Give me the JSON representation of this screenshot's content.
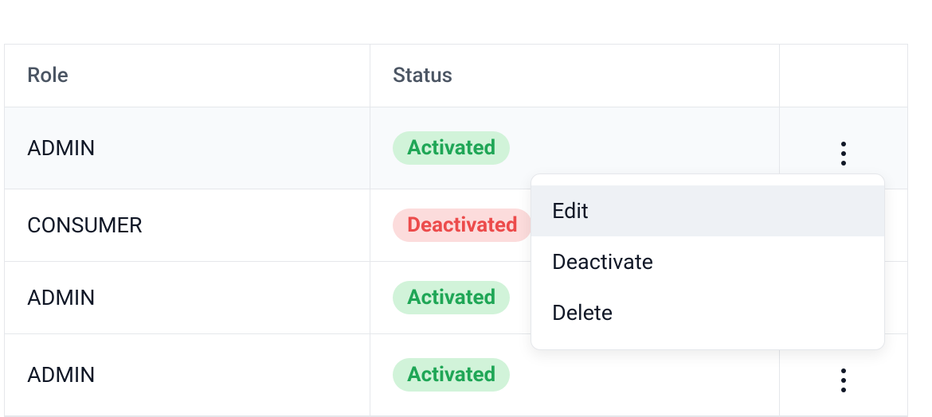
{
  "table": {
    "headers": {
      "role": "Role",
      "status": "Status",
      "actions": ""
    },
    "rows": [
      {
        "role": "ADMIN",
        "status_label": "Activated",
        "status_type": "activated",
        "highlighted": true,
        "show_kebab": true
      },
      {
        "role": "CONSUMER",
        "status_label": "Deactivated",
        "status_type": "deactivated",
        "highlighted": false,
        "show_kebab": false
      },
      {
        "role": "ADMIN",
        "status_label": "Activated",
        "status_type": "activated",
        "highlighted": false,
        "show_kebab": false
      },
      {
        "role": "ADMIN",
        "status_label": "Activated",
        "status_type": "activated",
        "highlighted": false,
        "show_kebab": true
      }
    ]
  },
  "dropdown": {
    "items": [
      {
        "label": "Edit",
        "highlighted": true
      },
      {
        "label": "Deactivate",
        "highlighted": false
      },
      {
        "label": "Delete",
        "highlighted": false
      }
    ]
  }
}
